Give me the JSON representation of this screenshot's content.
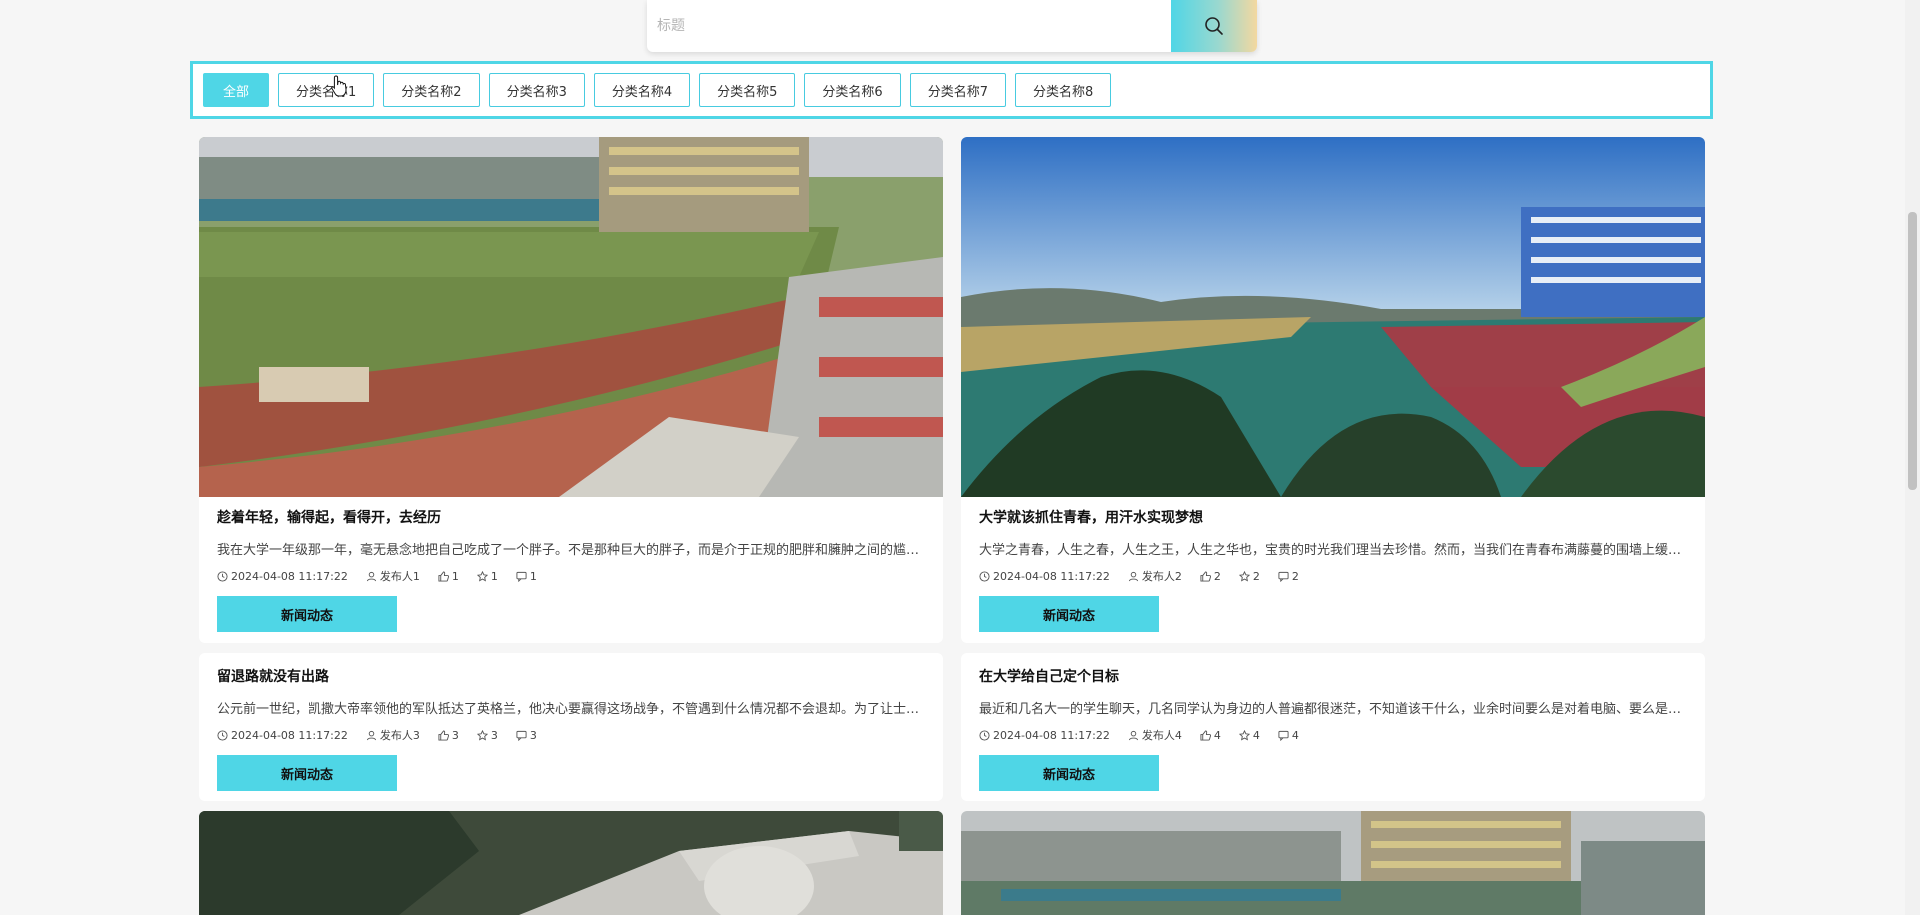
{
  "search": {
    "placeholder": "标题",
    "icon": "search-icon"
  },
  "categories": [
    {
      "label": "全部",
      "active": true
    },
    {
      "label": "分类名称1"
    },
    {
      "label": "分类名称2"
    },
    {
      "label": "分类名称3"
    },
    {
      "label": "分类名称4"
    },
    {
      "label": "分类名称5"
    },
    {
      "label": "分类名称6"
    },
    {
      "label": "分类名称7"
    },
    {
      "label": "分类名称8"
    }
  ],
  "cards": [
    {
      "title": "趁着年轻，输得起，看得开，去经历",
      "desc": "我在大学一年级那一年，毫无悬念地把自己吃成了一个胖子。不是那种巨大的胖子，而是介于正规的肥胖和臃肿之间的尴尬体...",
      "time": "2024-04-08 11:17:22",
      "publisher": "发布人1",
      "likes": "1",
      "favs": "1",
      "comments": "1",
      "tag": "新闻动态",
      "image": "campus-sports-field-image"
    },
    {
      "title": "大学就该抓住青春，用汗水实现梦想",
      "desc": "大学之青春，人生之春，人生之王，人生之华也，宝贵的时光我们理当去珍惜。然而，当我们在青春布满藤蔓的围墙上缓慢的...",
      "time": "2024-04-08 11:17:22",
      "publisher": "发布人2",
      "likes": "2",
      "favs": "2",
      "comments": "2",
      "tag": "新闻动态",
      "image": "basketball-courts-image"
    },
    {
      "title": "留退路就没有出路",
      "desc": "公元前一世纪，凯撒大帝率领他的军队抵达了英格兰，他决心要赢得这场战争，不管遇到什么情况都不会退却。为了让士兵们...",
      "time": "2024-04-08 11:17:22",
      "publisher": "发布人3",
      "likes": "3",
      "favs": "3",
      "comments": "3",
      "tag": "新闻动态"
    },
    {
      "title": "在大学给自己定个目标",
      "desc": "最近和几名大一的学生聊天，几名同学认为身边的人普遍都很迷茫，不知道该干什么，业余时间要么是对着电脑、要么是抱着...",
      "time": "2024-04-08 11:17:22",
      "publisher": "发布人4",
      "likes": "4",
      "favs": "4",
      "comments": "4",
      "tag": "新闻动态"
    },
    {
      "image": "stone-sculpture-image"
    },
    {
      "image": "campus-stadium-image"
    }
  ],
  "colors": {
    "accent": "#4fd6e6",
    "background": "#f6f6f6"
  }
}
